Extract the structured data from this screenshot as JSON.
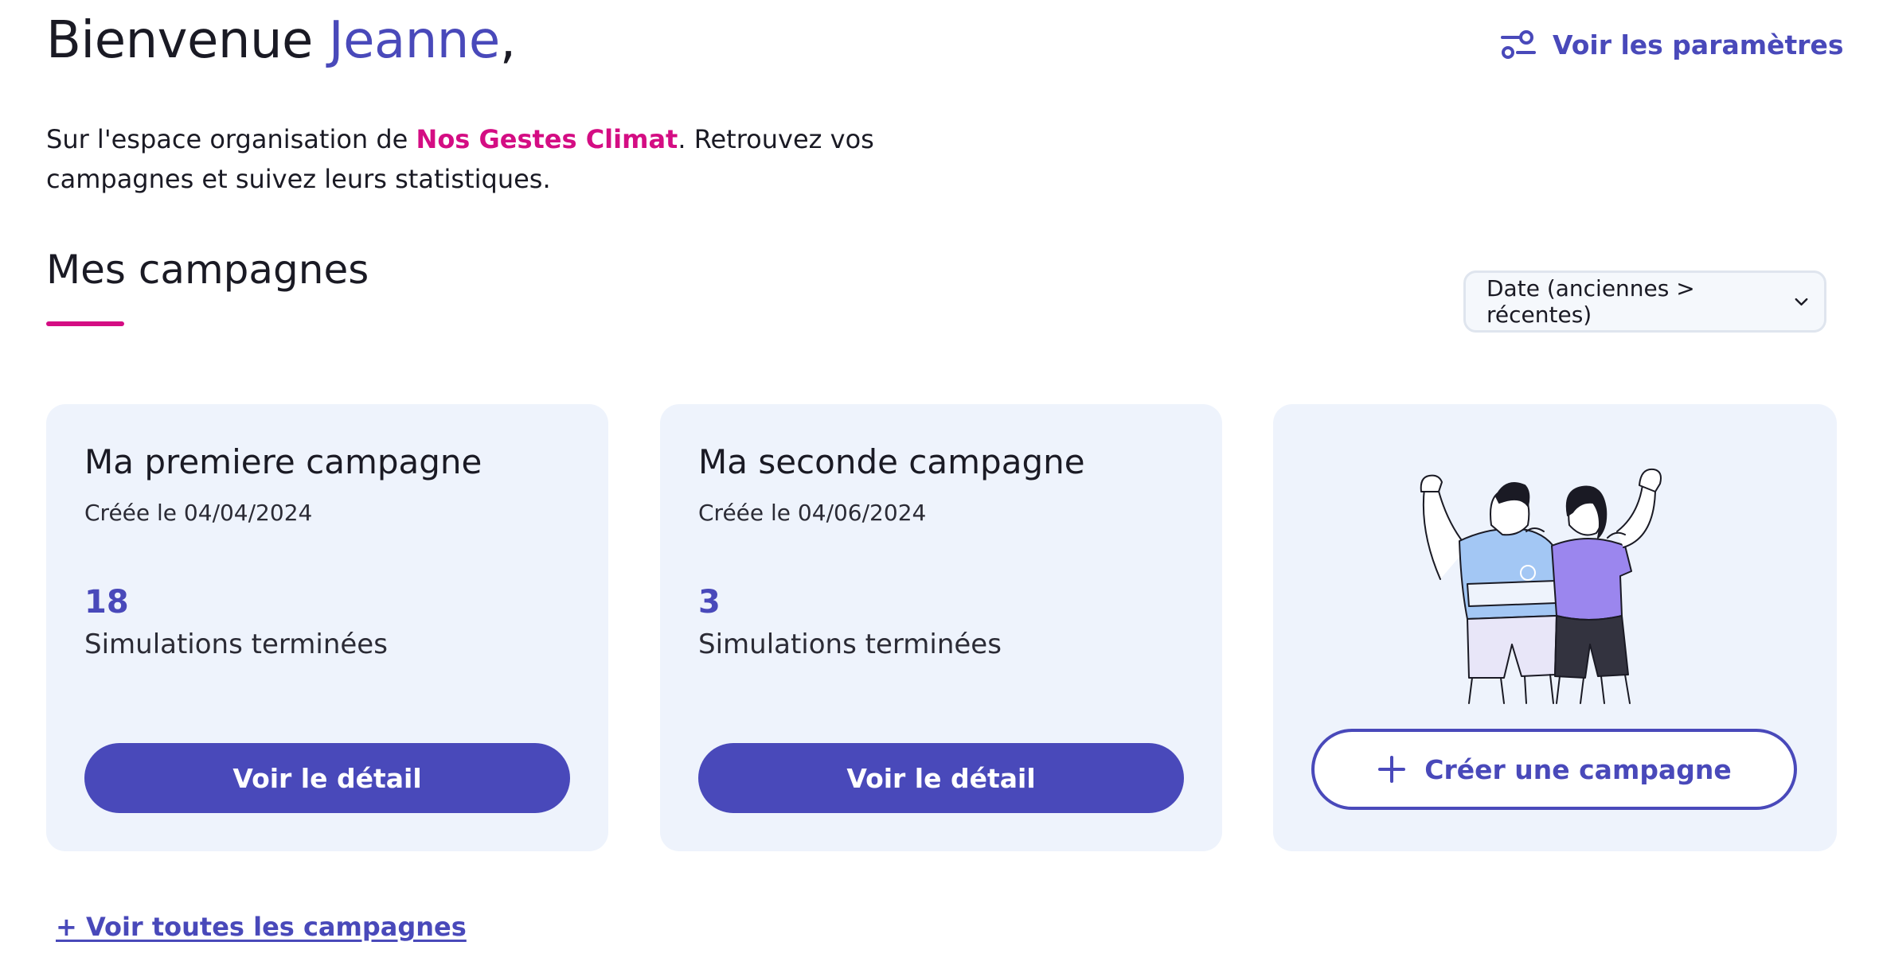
{
  "header": {
    "greeting": "Bienvenue",
    "user_name": "Jeanne",
    "greeting_suffix": ",",
    "settings_link": "Voir les paramètres",
    "settings_icon": "sliders-icon"
  },
  "intro": {
    "before": "Sur l'espace organisation de ",
    "brand": "Nos Gestes Climat",
    "after": ". Retrouvez vos campagnes et suivez leurs statistiques."
  },
  "section": {
    "title": "Mes campagnes"
  },
  "sort": {
    "selected": "Date (anciennes > récentes)",
    "icon": "chevron-down-icon"
  },
  "campaigns": [
    {
      "title": "Ma premiere campagne",
      "date": "Créée le 04/04/2024",
      "count": "18",
      "count_label": "Simulations terminées",
      "button": "Voir le détail"
    },
    {
      "title": "Ma seconde campagne",
      "date": "Créée le 04/06/2024",
      "count": "3",
      "count_label": "Simulations terminées",
      "button": "Voir le détail"
    }
  ],
  "create_card": {
    "button": "Créer une campagne",
    "button_icon": "plus-icon",
    "illustration": "two-people-flexing-illustration"
  },
  "footer": {
    "all_campaigns_link": "+ Voir toutes les campagnes"
  },
  "colors": {
    "accent": "#4949ba",
    "brand_pink": "#d40d83",
    "card_bg": "#eef3fc"
  }
}
